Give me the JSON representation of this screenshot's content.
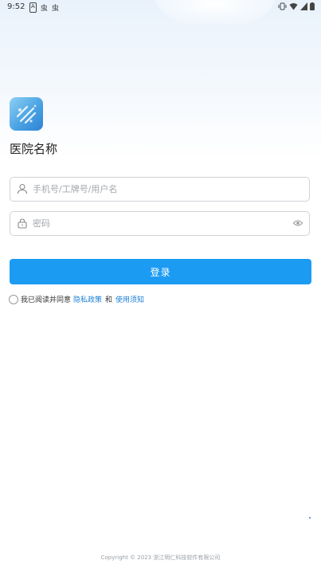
{
  "status_bar": {
    "time": "9:52",
    "left_icons": [
      "A",
      "虫",
      "虫"
    ],
    "right_icons": [
      "vibrate-icon",
      "wifi-icon",
      "signal-icon",
      "battery-icon"
    ]
  },
  "app": {
    "hospital_name": "医院名称"
  },
  "form": {
    "username_placeholder": "手机号/工牌号/用户名",
    "password_placeholder": "密码",
    "login_label": "登录"
  },
  "agreement": {
    "prefix": "我已阅读并同意",
    "privacy_link": "隐私政策",
    "and": "和",
    "terms_link": "使用须知"
  },
  "footer": {
    "copyright": "Copyright © 2023 浙江明仁科技软件有限公司"
  },
  "colors": {
    "primary": "#1c9bf3",
    "link": "#1c7fd8"
  }
}
